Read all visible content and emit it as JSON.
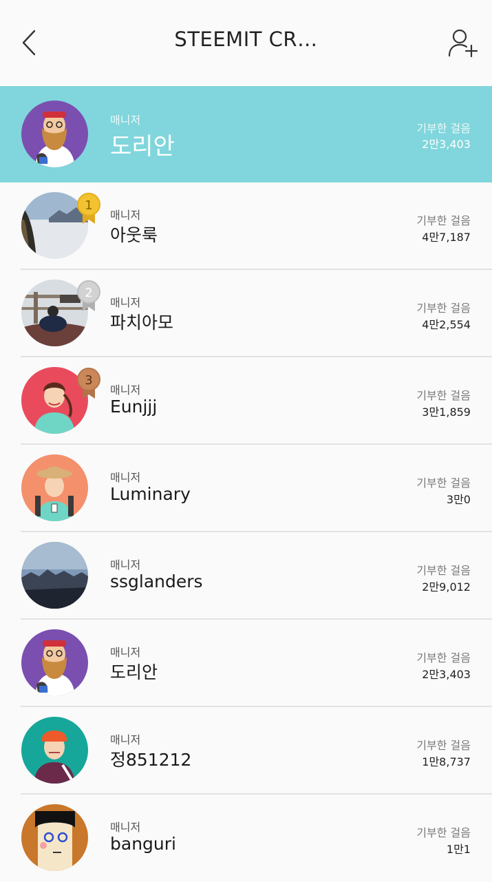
{
  "header": {
    "title": "STEEMIT CR…",
    "back_icon": "chevron-left-icon",
    "add_icon": "add-user-icon"
  },
  "colors": {
    "highlight_row": "#80d6dc",
    "gold_badge": "#f2c230",
    "silver_badge": "#c8c8c8",
    "bronze_badge": "#c9875a"
  },
  "current_user": {
    "role": "매니저",
    "name": "도리안",
    "steps_label": "기부한 걸음",
    "steps": "2만3,403"
  },
  "members": [
    {
      "rank": "1",
      "role": "매니저",
      "name": "아웃룩",
      "steps_label": "기부한 걸음",
      "steps": "4만7,187"
    },
    {
      "rank": "2",
      "role": "매니저",
      "name": "파치아모",
      "steps_label": "기부한 걸음",
      "steps": "4만2,554"
    },
    {
      "rank": "3",
      "role": "매니저",
      "name": "Eunjjj",
      "steps_label": "기부한 걸음",
      "steps": "3만1,859"
    },
    {
      "role": "매니저",
      "name": "Luminary",
      "steps_label": "기부한 걸음",
      "steps": "3만0"
    },
    {
      "role": "매니저",
      "name": "ssglanders",
      "steps_label": "기부한 걸음",
      "steps": "2만9,012"
    },
    {
      "role": "매니저",
      "name": "도리안",
      "steps_label": "기부한 걸음",
      "steps": "2만3,403"
    },
    {
      "role": "매니저",
      "name": "정851212",
      "steps_label": "기부한 걸음",
      "steps": "1만8,737"
    },
    {
      "role": "매니저",
      "name": "banguri",
      "steps_label": "기부한 걸음",
      "steps": "1만1"
    }
  ]
}
